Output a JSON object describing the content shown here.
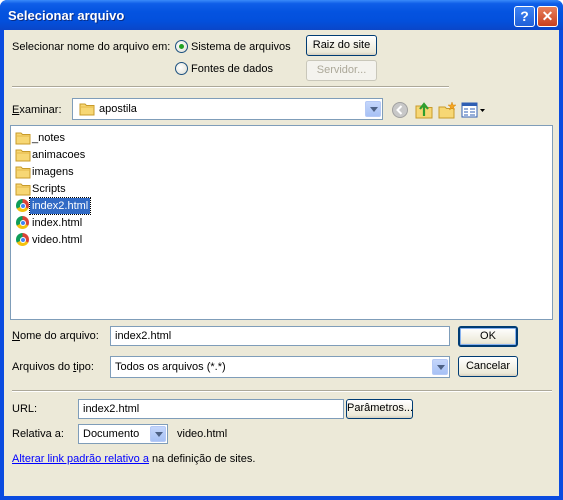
{
  "window": {
    "title": "Selecionar arquivo",
    "help_glyph": "?",
    "close_glyph": "✕"
  },
  "select_from": {
    "label": "Selecionar nome do arquivo em:",
    "option_filesystem": "Sistema de arquivos",
    "option_datasources": "Fontes de dados",
    "selected": "Sistema de arquivos",
    "site_root_button": "Raiz do site",
    "server_button": "Servidor..."
  },
  "look_in": {
    "label_prefix": "",
    "label_access": "E",
    "label_rest": "xaminar:",
    "value": "apostila"
  },
  "files": [
    {
      "name": "_notes",
      "type": "folder"
    },
    {
      "name": "animacoes",
      "type": "folder"
    },
    {
      "name": "imagens",
      "type": "folder"
    },
    {
      "name": "Scripts",
      "type": "folder"
    },
    {
      "name": "index2.html",
      "type": "html",
      "selected": true
    },
    {
      "name": "index.html",
      "type": "html"
    },
    {
      "name": "video.html",
      "type": "html"
    }
  ],
  "filename": {
    "label_prefix": "",
    "label_access": "N",
    "label_rest": "ome do arquivo:",
    "value": "index2.html",
    "ok_button": "OK"
  },
  "filetype": {
    "label_prefix": "Arquivos do ",
    "label_access": "t",
    "label_rest": "ipo:",
    "value": "Todos os arquivos (*.*)",
    "cancel_button": "Cancelar"
  },
  "url": {
    "label": "URL:",
    "value": "index2.html",
    "params_button": "Parâmetros..."
  },
  "relative": {
    "label": "Relativa a:",
    "value": "Documento",
    "target": "video.html"
  },
  "footer": {
    "link_text": "Alterar link padrão relativo a",
    "rest_text": " na definição de sites."
  },
  "colors": {
    "titlebar": "#0453e0",
    "dialog_bg": "#ece9d8",
    "selection": "#316ac5",
    "link": "#0000ff"
  },
  "icons": [
    "folder-icon",
    "chrome-icon",
    "back-icon",
    "up-folder-icon",
    "new-folder-icon",
    "view-menu-icon",
    "help-icon",
    "close-icon"
  ]
}
